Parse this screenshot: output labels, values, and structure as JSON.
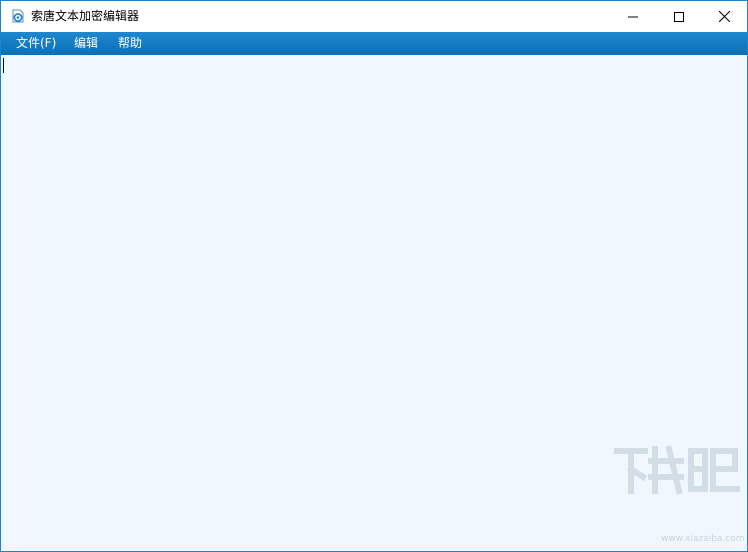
{
  "window": {
    "title": "索唐文本加密编辑器",
    "app_icon": "app-logo-icon",
    "controls": {
      "minimize_icon": "minimize-icon",
      "maximize_icon": "maximize-icon",
      "close_icon": "close-icon"
    }
  },
  "menubar": {
    "items": [
      {
        "label": "文件(F)"
      },
      {
        "label": "编辑"
      },
      {
        "label": "帮助"
      }
    ]
  },
  "editor": {
    "content": ""
  },
  "watermark": {
    "url": "www.xiazaiba.com"
  },
  "colors": {
    "menubar": "#0b78c6",
    "editor_bg": "#f1f7fe",
    "border": "#1a86c9"
  }
}
